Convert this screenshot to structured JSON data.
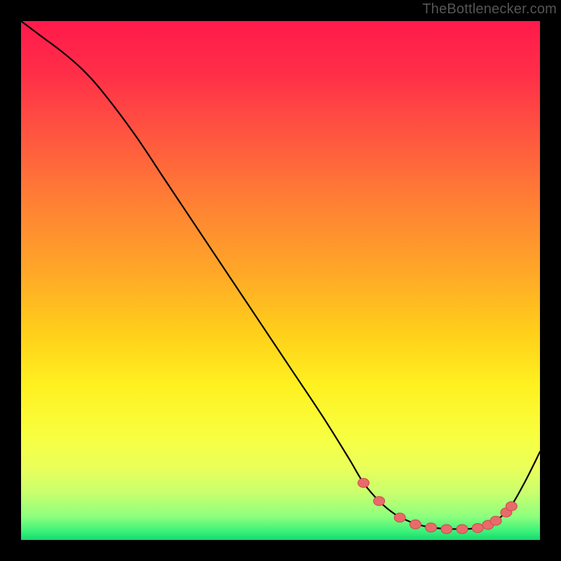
{
  "attribution": "TheBottlenecker.com",
  "colors": {
    "curve": "#000000",
    "marker_fill": "#e96a6a",
    "marker_stroke": "#c94a4a"
  },
  "gradient_stops": [
    {
      "offset": 0.0,
      "color": "#ff1a4b"
    },
    {
      "offset": 0.1,
      "color": "#ff2e48"
    },
    {
      "offset": 0.22,
      "color": "#ff5640"
    },
    {
      "offset": 0.35,
      "color": "#ff8034"
    },
    {
      "offset": 0.48,
      "color": "#ffa628"
    },
    {
      "offset": 0.6,
      "color": "#ffcf1a"
    },
    {
      "offset": 0.7,
      "color": "#fff020"
    },
    {
      "offset": 0.8,
      "color": "#f8ff40"
    },
    {
      "offset": 0.86,
      "color": "#eaff5a"
    },
    {
      "offset": 0.91,
      "color": "#c8ff6e"
    },
    {
      "offset": 0.955,
      "color": "#8dff7e"
    },
    {
      "offset": 0.985,
      "color": "#36f07a"
    },
    {
      "offset": 1.0,
      "color": "#17d86e"
    }
  ],
  "chart_data": {
    "type": "line",
    "title": "",
    "xlabel": "",
    "ylabel": "",
    "xlim": [
      0,
      100
    ],
    "ylim": [
      0,
      100
    ],
    "x": [
      0,
      4,
      8,
      12,
      16,
      22,
      28,
      34,
      40,
      46,
      52,
      58,
      63,
      66,
      69,
      72,
      75,
      78,
      81,
      84,
      87,
      89,
      91,
      94,
      97,
      100
    ],
    "y": [
      100,
      97,
      94,
      90.5,
      86,
      78,
      69,
      60,
      51,
      42,
      33,
      24,
      16,
      11,
      7.5,
      5,
      3.5,
      2.6,
      2.2,
      2.1,
      2.2,
      2.6,
      3.4,
      6,
      11,
      17
    ],
    "markers": [
      {
        "x": 66,
        "y": 11
      },
      {
        "x": 69,
        "y": 7.5
      },
      {
        "x": 73,
        "y": 4.3
      },
      {
        "x": 76,
        "y": 3.0
      },
      {
        "x": 79,
        "y": 2.4
      },
      {
        "x": 82,
        "y": 2.1
      },
      {
        "x": 85,
        "y": 2.1
      },
      {
        "x": 88,
        "y": 2.3
      },
      {
        "x": 90,
        "y": 2.9
      },
      {
        "x": 91.5,
        "y": 3.7
      },
      {
        "x": 93.5,
        "y": 5.3
      },
      {
        "x": 94.5,
        "y": 6.5
      }
    ]
  }
}
